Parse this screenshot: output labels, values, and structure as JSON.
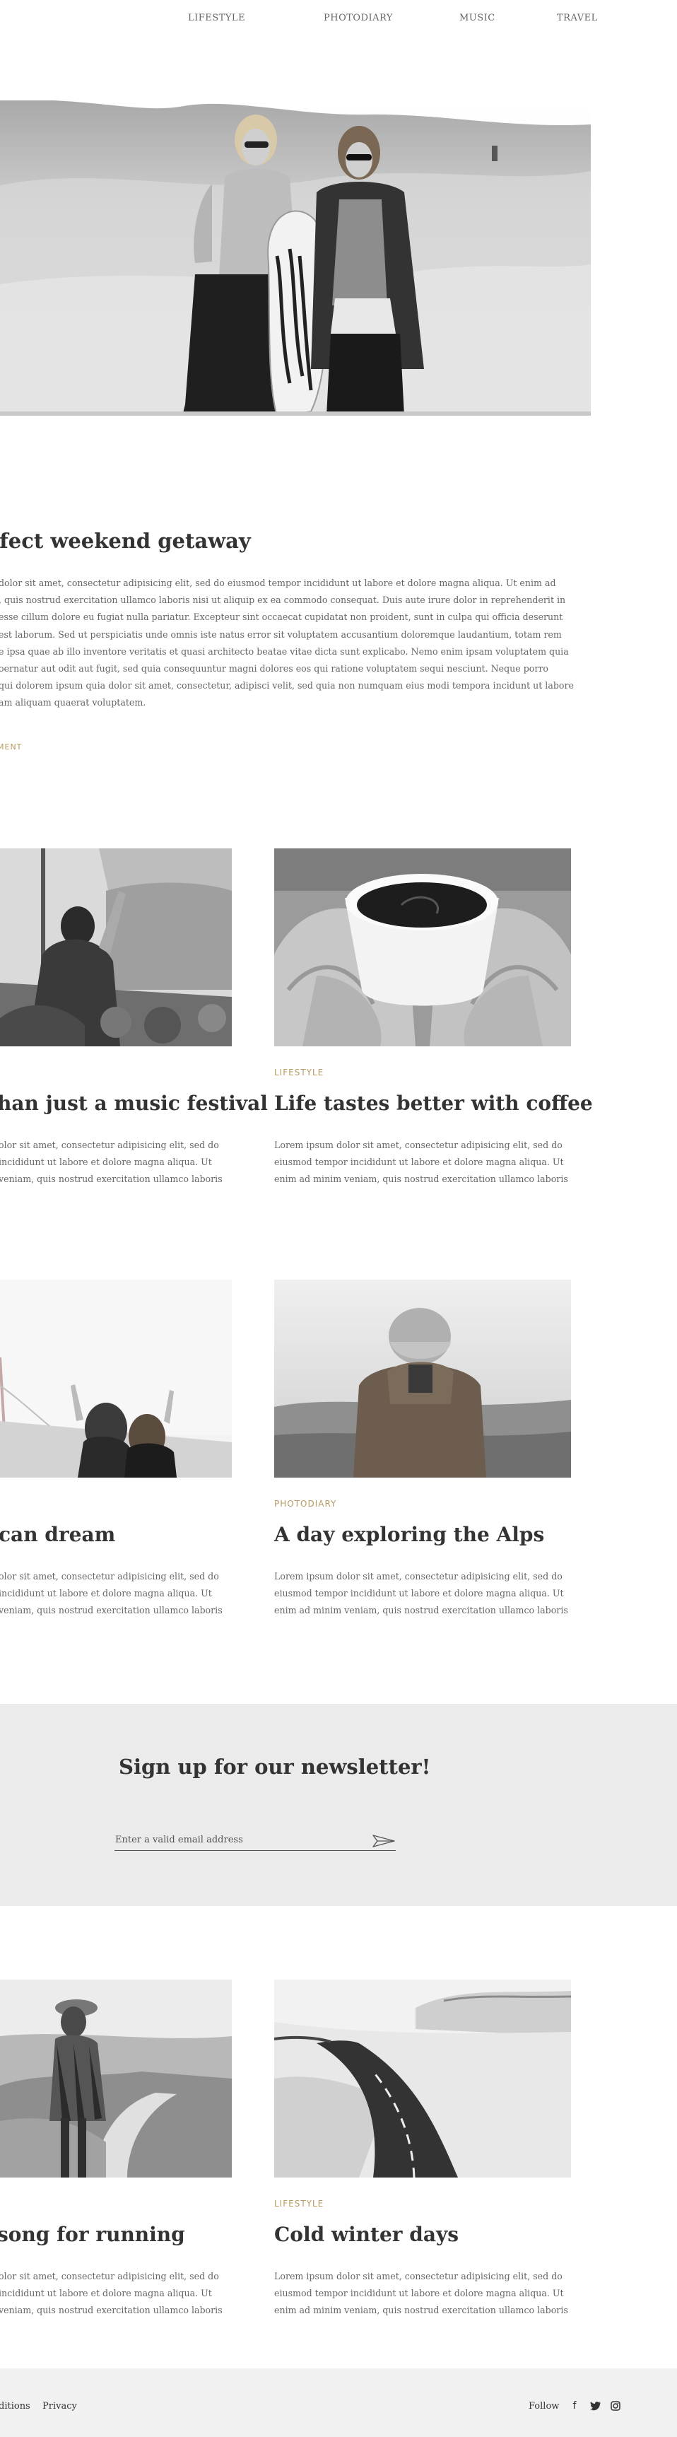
{
  "nav": {
    "items": [
      {
        "label": "LIFESTYLE"
      },
      {
        "label": "PHOTODIARY"
      },
      {
        "label": "MUSIC"
      },
      {
        "label": "TRAVEL"
      }
    ]
  },
  "article": {
    "title": "rfect weekend getaway",
    "lines": [
      "dolor sit amet, consectetur adipisicing elit, sed do eiusmod tempor incididunt ut labore et dolore magna aliqua. Ut enim ad",
      ", quis nostrud exercitation ullamco laboris nisi ut aliquip ex ea commodo consequat. Duis aute irure dolor in reprehenderit in",
      "esse cillum dolore eu fugiat nulla pariatur. Excepteur sint occaecat cupidatat non proident, sunt in culpa qui officia deserunt",
      "est laborum. Sed ut perspiciatis unde omnis iste natus error sit voluptatem accusantium doloremque laudantium, totam rem",
      "e ipsa quae ab illo inventore veritatis et quasi architecto beatae vitae dicta sunt explicabo. Nemo enim ipsam voluptatem quia",
      "oernatur aut odit aut fugit, sed quia consequuntur magni dolores eos qui ratione voluptatem sequi nesciunt. Neque porro",
      "qui dolorem ipsum quia dolor sit amet, consectetur, adipisci velit, sed quia non numquam eius modi tempora incidunt ut labore",
      "am aliquam quaerat voluptatem."
    ],
    "comment_label": "MENT"
  },
  "cards": [
    {
      "category": "",
      "title": "han just a music festival",
      "lines": [
        "olor sit amet, consectetur adipisicing elit, sed do",
        "incididunt ut labore et dolore magna aliqua. Ut",
        "veniam, quis nostrud exercitation ullamco laboris"
      ]
    },
    {
      "category": "LIFESTYLE",
      "title": "Life tastes better with coffee",
      "lines": [
        "Lorem ipsum dolor sit amet, consectetur adipisicing elit, sed do",
        "eiusmod tempor incididunt ut labore et dolore magna aliqua. Ut",
        "enim ad minim veniam, quis nostrud exercitation ullamco laboris"
      ]
    },
    {
      "category": "",
      "title": "can dream",
      "lines": [
        "olor sit amet, consectetur adipisicing elit, sed do",
        "incididunt ut labore et dolore magna aliqua. Ut",
        "veniam, quis nostrud exercitation ullamco laboris"
      ]
    },
    {
      "category": "PHOTODIARY",
      "title": "A day exploring the Alps",
      "lines": [
        "Lorem ipsum dolor sit amet, consectetur adipisicing elit, sed do",
        "eiusmod tempor incididunt ut labore et dolore magna aliqua. Ut",
        "enim ad minim veniam, quis nostrud exercitation ullamco laboris"
      ]
    },
    {
      "category": "",
      "title": "song for running",
      "lines": [
        "olor sit amet, consectetur adipisicing elit, sed do",
        "incididunt ut labore et dolore magna aliqua. Ut",
        "veniam, quis nostrud exercitation ullamco laboris"
      ]
    },
    {
      "category": "LIFESTYLE",
      "title": "Cold winter days",
      "lines": [
        "Lorem ipsum dolor sit amet, consectetur adipisicing elit, sed do",
        "eiusmod tempor incididunt ut labore et dolore magna aliqua. Ut",
        "enim ad minim veniam, quis nostrud exercitation ullamco laboris"
      ]
    }
  ],
  "newsletter": {
    "title": "Sign up for our newsletter!",
    "placeholder": "Enter a valid email address",
    "value": "",
    "send_icon": "paper-plane-icon"
  },
  "footer": {
    "links": [
      {
        "label": "ditions"
      },
      {
        "label": "Privacy"
      }
    ],
    "follow_label": "Follow",
    "social": [
      {
        "icon": "facebook-icon",
        "glyph": "f"
      },
      {
        "icon": "twitter-icon",
        "glyph": "🐦"
      },
      {
        "icon": "instagram-icon",
        "glyph": "◎"
      }
    ]
  },
  "colors": {
    "accent": "#b59a63",
    "text": "#333333",
    "body_text": "#666666",
    "newsletter_bg": "#ebebeb",
    "footer_bg": "#f1f1f1"
  }
}
